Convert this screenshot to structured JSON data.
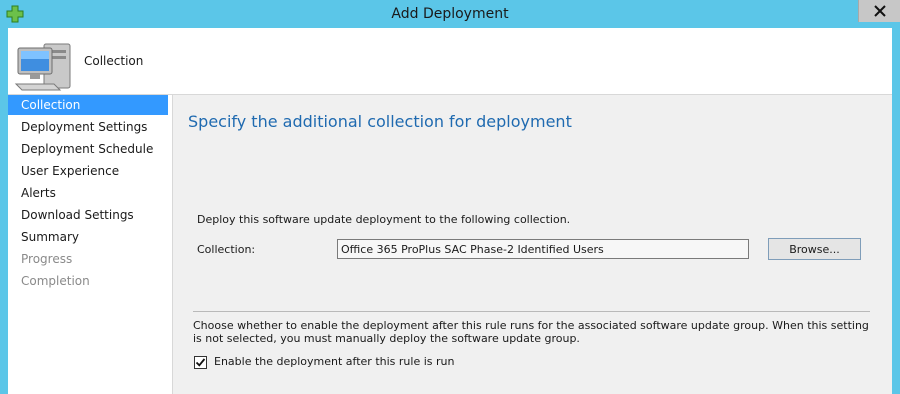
{
  "window": {
    "title": "Add Deployment",
    "icon": "green-plus-icon"
  },
  "header": {
    "title": "Collection",
    "icon": "computer-icon"
  },
  "nav": {
    "items": [
      {
        "label": "Collection",
        "state": "active"
      },
      {
        "label": "Deployment Settings",
        "state": "enabled"
      },
      {
        "label": "Deployment Schedule",
        "state": "enabled"
      },
      {
        "label": "User Experience",
        "state": "enabled"
      },
      {
        "label": "Alerts",
        "state": "enabled"
      },
      {
        "label": "Download Settings",
        "state": "enabled"
      },
      {
        "label": "Summary",
        "state": "enabled"
      },
      {
        "label": "Progress",
        "state": "disabled"
      },
      {
        "label": "Completion",
        "state": "disabled"
      }
    ]
  },
  "main": {
    "heading": "Specify the additional collection for deployment",
    "intro": "Deploy this software update deployment to the following collection.",
    "collection_label": "Collection:",
    "collection_value": "Office 365 ProPlus SAC Phase-2 Identified Users",
    "browse_label": "Browse...",
    "choose_text": "Choose whether to enable the deployment after this rule runs for the associated software update group. When this setting is not selected, you must manually deploy the software update group.",
    "enable_checkbox_label": "Enable the deployment after this rule is run",
    "enable_checked": true
  },
  "colors": {
    "accent": "#3399ff",
    "heading": "#1f6ab0",
    "frame": "#5bc6e8"
  }
}
